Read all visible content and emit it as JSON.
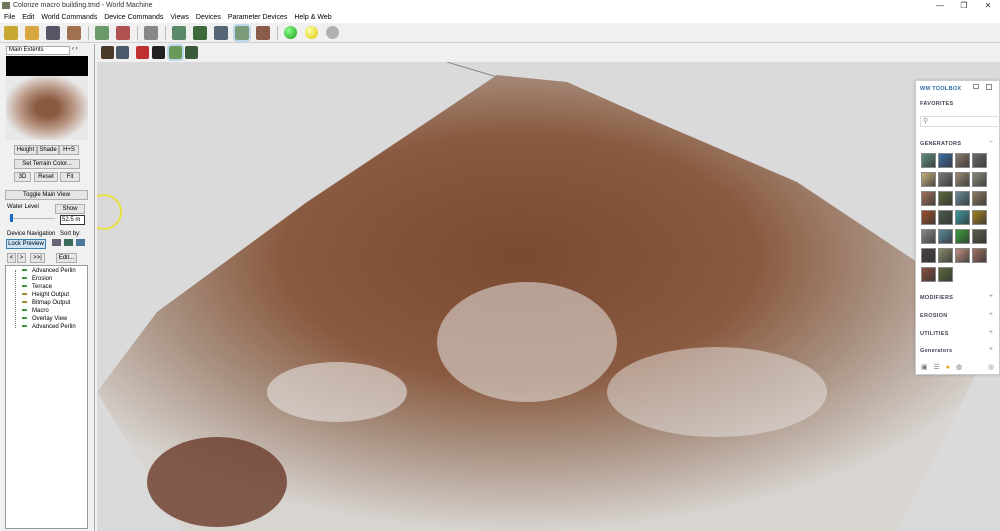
{
  "window": {
    "title": "Colorize macro building.tmd - World Machine",
    "minimize": "—",
    "maximize": "❐",
    "close": "✕"
  },
  "menu": [
    "File",
    "Edit",
    "World Commands",
    "Device Commands",
    "Views",
    "Devices",
    "Parameter Devices",
    "Help & Web"
  ],
  "left": {
    "extents": "Main Extents",
    "height": "Height",
    "shade": "Shade",
    "hs": "H+S",
    "set_color": "Set Terrain Color...",
    "b3d": "3D",
    "reset": "Reset",
    "fit": "Fit",
    "toggle": "Toggle Main View",
    "water_label": "Water Level",
    "show": "Show",
    "water_value": "52.5 m",
    "water_level_fraction": 0.05,
    "nav_label": "Device Navigation",
    "sort_label": "Sort by:",
    "lock": "Lock Preview",
    "prev": "<",
    "next": ">",
    "last": ">>|",
    "edit": "Edit...",
    "devices": [
      {
        "name": "Advanced Perlin",
        "color": "#3a9a3a"
      },
      {
        "name": "Erosion",
        "color": "#3a9a3a"
      },
      {
        "name": "Terrace",
        "color": "#3a9a3a"
      },
      {
        "name": "Height Output",
        "color": "#9a8a30"
      },
      {
        "name": "Bitmap Output",
        "color": "#9a8a30"
      },
      {
        "name": "Macro",
        "color": "#3a9a3a"
      },
      {
        "name": "Overlay View",
        "color": "#3a9a3a"
      },
      {
        "name": "Advanced Perlin",
        "color": "#3a9a3a"
      }
    ]
  },
  "toolbox": {
    "title": "WM TOOLBOX",
    "favorites": "FAVORITES",
    "generators": "GENERATORS",
    "modifiers": "MODIFIERS",
    "erosion": "EROSION",
    "utilities": "UTILITIES",
    "generators2": "Generators",
    "plus": "+",
    "minus": "−",
    "tiles": [
      "#5f8f7a",
      "#3d6fa8",
      "#8a7a6a",
      "#6a6a6a",
      "#c8b080",
      "#7a7a7a",
      "#9a8a70",
      "#8a8a7a",
      "#a0705a",
      "#5a6a3a",
      "#6a8a9a",
      "#8a7a60",
      "#a0502a",
      "#4a5a4a",
      "#3a9aa0",
      "#a08020",
      "#8a8a8a",
      "#5a8a9a",
      "#3aa03a",
      "#5a5a4a",
      "#4a4040",
      "#8a8a6a",
      "#c09080",
      "#a07060",
      "#8a5040",
      "#5a6a3a"
    ]
  }
}
